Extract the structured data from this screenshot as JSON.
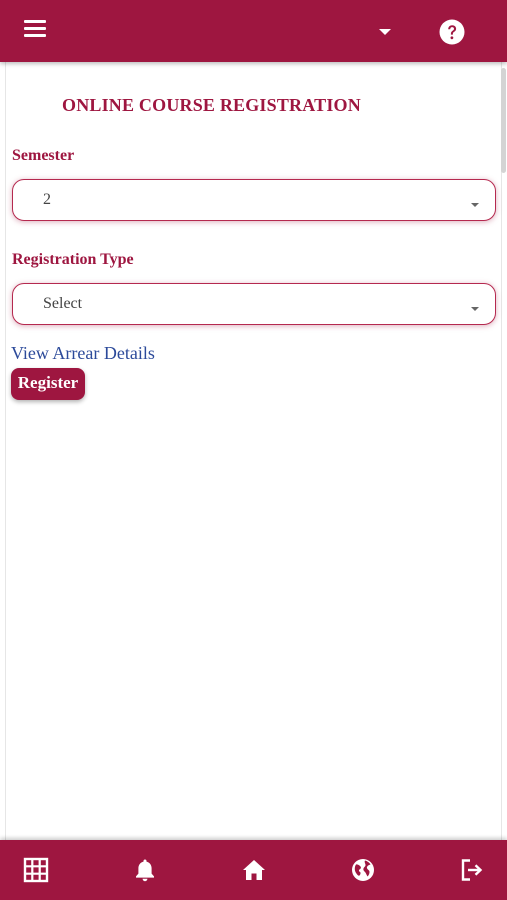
{
  "header": {
    "menu_icon": "hamburger-menu-icon",
    "dropdown_icon": "caret-down-icon",
    "help_icon": "help-circle-icon"
  },
  "page": {
    "title": "ONLINE COURSE REGISTRATION"
  },
  "form": {
    "semester_label": "Semester",
    "semester_value": "2",
    "registration_type_label": "Registration Type",
    "registration_type_value": "Select",
    "arrear_link": "View Arrear Details",
    "register_button": "Register"
  },
  "bottom_nav": {
    "items": [
      {
        "icon": "grid-icon"
      },
      {
        "icon": "bell-icon"
      },
      {
        "icon": "home-icon"
      },
      {
        "icon": "globe-icon"
      },
      {
        "icon": "logout-icon"
      }
    ]
  },
  "colors": {
    "brand": "#9e1640",
    "link": "#2c4a9a"
  }
}
